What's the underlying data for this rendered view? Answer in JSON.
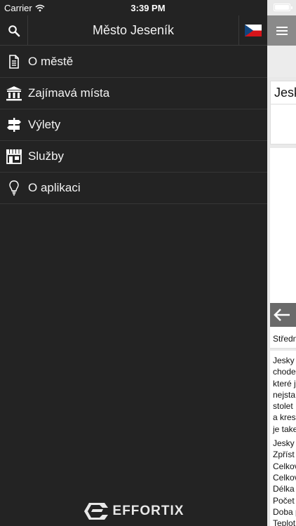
{
  "status_bar": {
    "carrier": "Carrier",
    "time": "3:39 PM"
  },
  "header": {
    "title": "Město Jeseník",
    "search_icon": "search-icon",
    "language_flag": "czech-flag-icon"
  },
  "menu": {
    "items": [
      {
        "label": "O městě",
        "icon": "document-icon"
      },
      {
        "label": "Zajímavá místa",
        "icon": "museum-icon"
      },
      {
        "label": "Výlety",
        "icon": "signpost-icon"
      },
      {
        "label": "Služby",
        "icon": "shop-icon"
      },
      {
        "label": "O aplikaci",
        "icon": "lightbulb-icon"
      }
    ]
  },
  "branding": {
    "name": "EFFORTIX"
  },
  "content_peek": {
    "card_title": "Jesk",
    "caption": "Středn",
    "paragraph1": [
      "Jesky",
      "chode",
      "které j",
      "nejsta",
      "stolet",
      "a kres",
      "je take"
    ],
    "paragraph2": [
      "Jesky",
      "Zpříst",
      "Celkov",
      "Celkov",
      "Délka",
      "Počet",
      "Doba p",
      "Teplot"
    ]
  },
  "colors": {
    "drawer_bg": "#232323",
    "divider": "#363636",
    "content_bg": "#e9e9e9",
    "hamburger_bg": "#8a8a8a"
  }
}
